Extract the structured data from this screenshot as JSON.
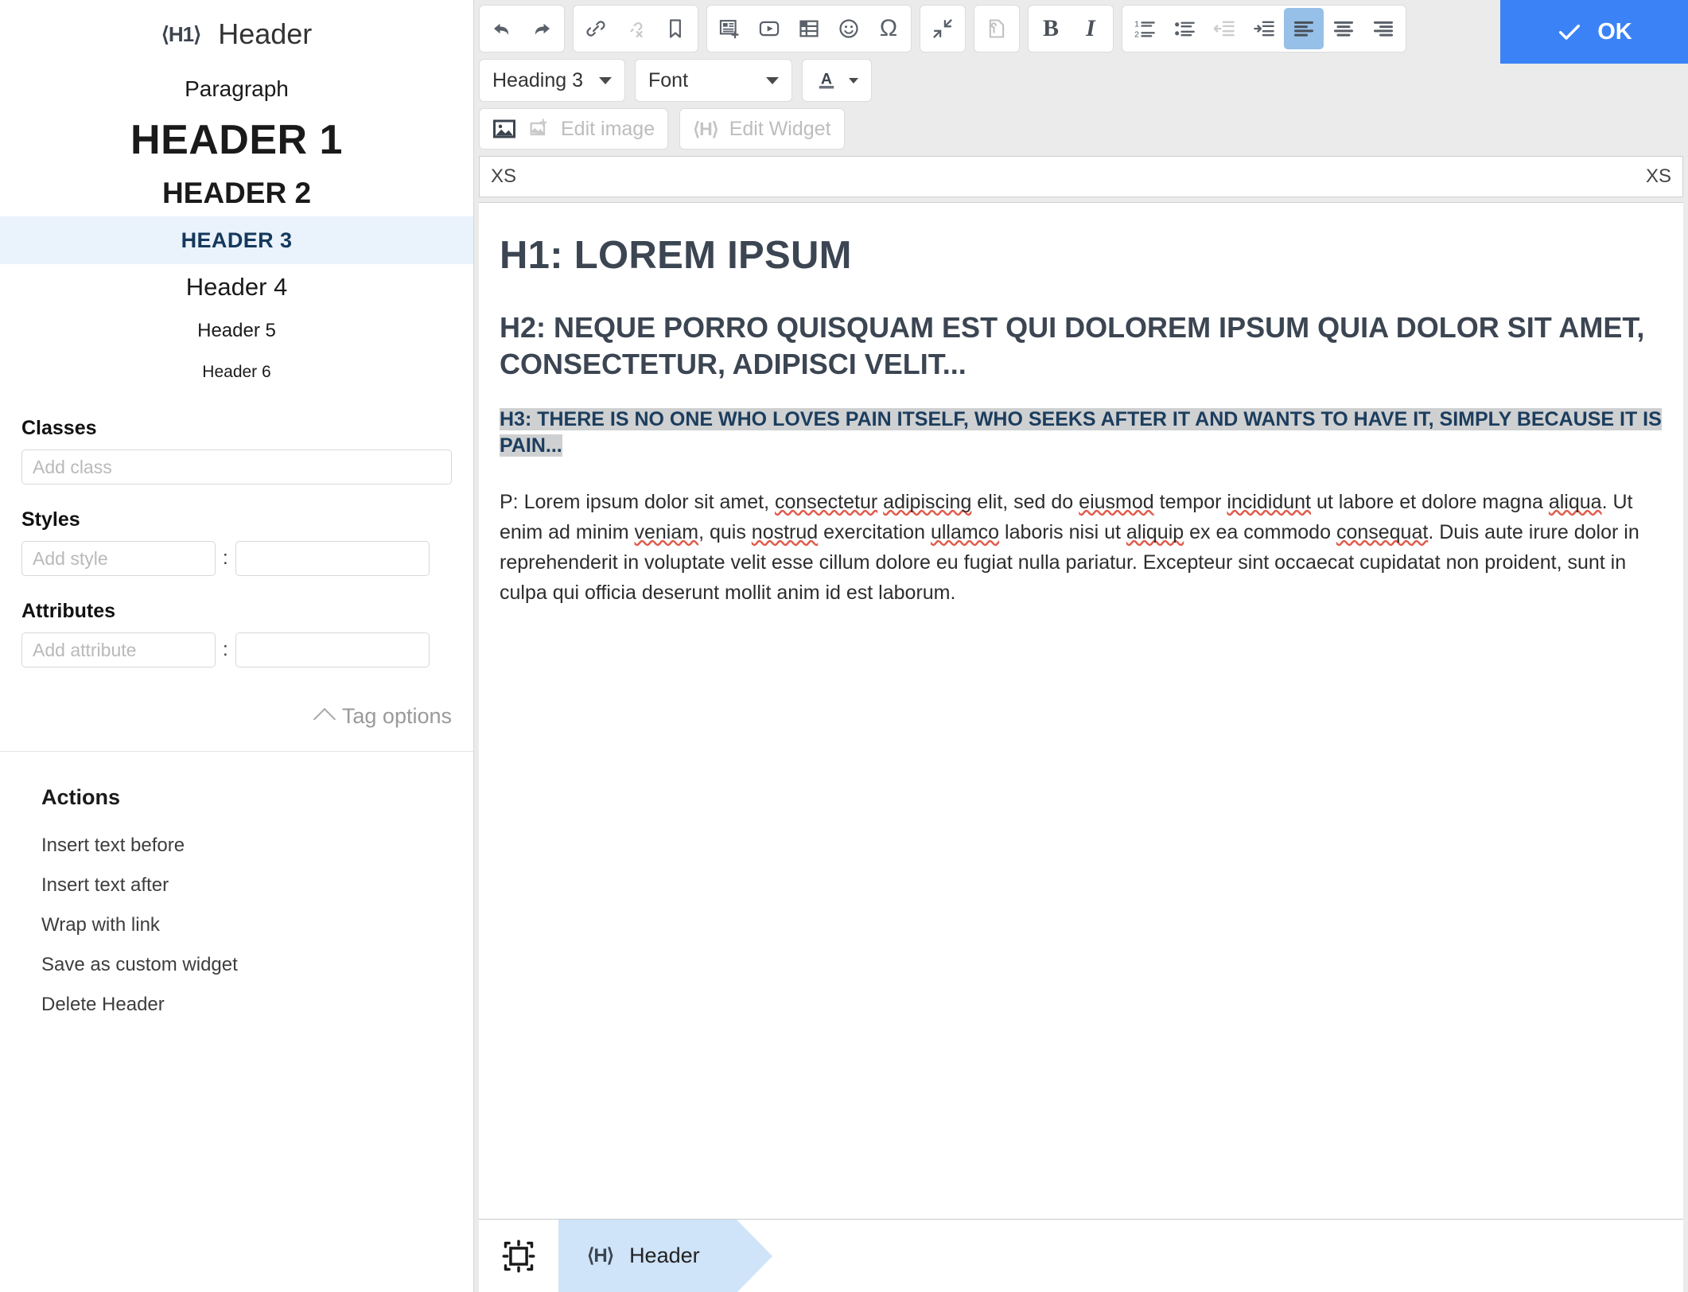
{
  "sidebar": {
    "tag_icon": "⟨H1⟩",
    "title": "Header",
    "preview_rows": [
      {
        "label": "Paragraph",
        "kind": "paragraph",
        "active": false
      },
      {
        "label": "HEADER 1",
        "kind": "h1",
        "active": false
      },
      {
        "label": "HEADER 2",
        "kind": "h2",
        "active": false
      },
      {
        "label": "HEADER 3",
        "kind": "h3",
        "active": true
      },
      {
        "label": "Header 4",
        "kind": "h4",
        "active": false
      },
      {
        "label": "Header 5",
        "kind": "h5",
        "active": false
      },
      {
        "label": "Header 6",
        "kind": "h6",
        "active": false
      }
    ],
    "classes": {
      "label": "Classes",
      "placeholder": "Add class",
      "value": ""
    },
    "styles": {
      "label": "Styles",
      "name_placeholder": "Add style",
      "separator": ":",
      "name_value": "",
      "value_value": ""
    },
    "attributes": {
      "label": "Attributes",
      "name_placeholder": "Add attribute",
      "separator": ":",
      "name_value": "",
      "value_value": ""
    },
    "tag_options": {
      "label": "Tag options",
      "icon": "chevron-up-icon"
    },
    "actions": {
      "title": "Actions",
      "items": [
        "Insert text before",
        "Insert text after",
        "Wrap with link",
        "Save as custom widget",
        "Delete Header"
      ]
    }
  },
  "toolbar": {
    "ok_button": {
      "label": "OK",
      "icon": "check-icon",
      "color": "#3b82f6"
    },
    "groups": [
      {
        "name": "history",
        "buttons": [
          {
            "icon": "undo-icon",
            "state": "enabled"
          },
          {
            "icon": "redo-icon",
            "state": "enabled"
          }
        ]
      },
      {
        "name": "links",
        "buttons": [
          {
            "icon": "link-icon",
            "state": "enabled"
          },
          {
            "icon": "unlink-icon",
            "state": "disabled"
          },
          {
            "icon": "anchor-bookmark-icon",
            "state": "enabled"
          }
        ]
      },
      {
        "name": "insert",
        "buttons": [
          {
            "icon": "insert-snippet-icon",
            "state": "enabled"
          },
          {
            "icon": "video-icon",
            "state": "enabled"
          },
          {
            "icon": "table-icon",
            "state": "enabled"
          },
          {
            "icon": "emoji-icon",
            "state": "enabled"
          },
          {
            "icon": "special-character-omega-icon",
            "state": "enabled"
          }
        ]
      },
      {
        "name": "collapse",
        "buttons": [
          {
            "icon": "collapse-arrows-icon",
            "state": "enabled"
          }
        ]
      },
      {
        "name": "source",
        "buttons": [
          {
            "icon": "page-wrench-icon",
            "state": "disabled"
          }
        ]
      },
      {
        "name": "format",
        "buttons": [
          {
            "icon": "bold-icon",
            "state": "enabled"
          },
          {
            "icon": "italic-icon",
            "state": "enabled"
          }
        ]
      },
      {
        "name": "paragraph",
        "buttons": [
          {
            "icon": "ordered-list-icon",
            "state": "enabled"
          },
          {
            "icon": "unordered-list-icon",
            "state": "enabled"
          },
          {
            "icon": "outdent-icon",
            "state": "disabled"
          },
          {
            "icon": "indent-icon",
            "state": "enabled"
          },
          {
            "icon": "align-left-icon",
            "state": "active"
          },
          {
            "icon": "align-center-icon",
            "state": "enabled"
          },
          {
            "icon": "align-right-icon",
            "state": "enabled"
          }
        ]
      }
    ],
    "style_select": {
      "value": "Heading 3",
      "icon": "chevron-down-icon"
    },
    "font_select": {
      "value": "Font",
      "icon": "chevron-down-icon"
    },
    "text_color": {
      "glyph": "A",
      "icon": "text-color-icon"
    },
    "edit_image_button": {
      "label": "Edit image",
      "icon": "image-icon",
      "state": "disabled"
    },
    "edit_widget_button": {
      "label": "Edit Widget",
      "icon": "widget-tag-icon",
      "state": "disabled"
    }
  },
  "breakpoint_bar": {
    "left": "XS",
    "right": "XS"
  },
  "document": {
    "h1": "H1: LOREM IPSUM",
    "h2": "H2: NEQUE PORRO QUISQUAM EST QUI DOLOREM IPSUM QUIA DOLOR SIT AMET, CONSECTETUR, ADIPISCI VELIT...",
    "h3": "H3: THERE IS NO ONE WHO LOVES PAIN ITSELF, WHO SEEKS AFTER IT AND WANTS TO HAVE IT, SIMPLY BECAUSE IT IS PAIN...",
    "paragraph_prefix": "P: Lorem ipsum dolor sit amet, ",
    "paragraph_full": "P: Lorem ipsum dolor sit amet, consectetur adipiscing elit, sed do eiusmod tempor incididunt ut labore et dolore magna aliqua. Ut enim ad minim veniam, quis nostrud exercitation ullamco laboris nisi ut aliquip ex ea commodo consequat. Duis aute irure dolor in reprehenderit in voluptate velit esse cillum dolore eu fugiat nulla pariatur. Excepteur sint occaecat cupidatat non proident, sunt in culpa qui officia deserunt mollit anim id est laborum."
  },
  "statusbar": {
    "select_icon": "select-element-icon",
    "crumb": {
      "icon": "⟨H⟩",
      "label": "Header"
    }
  }
}
